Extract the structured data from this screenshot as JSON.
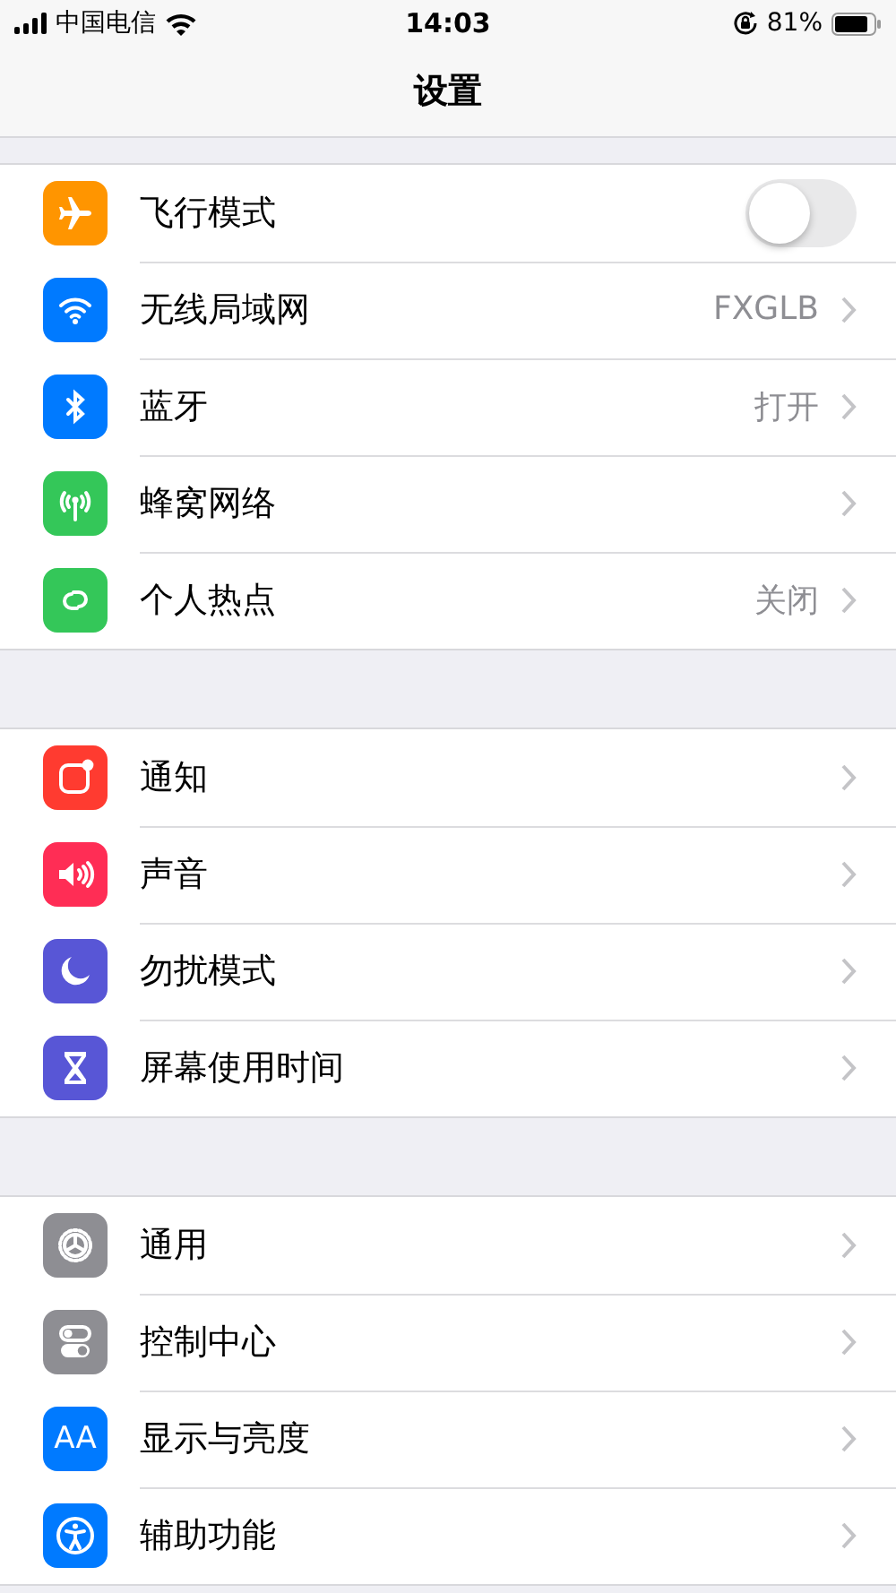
{
  "status_bar": {
    "carrier": "中国电信",
    "time": "14:03",
    "battery": "81%"
  },
  "title": "设置",
  "groups": [
    {
      "items": [
        {
          "kind": "toggle",
          "color": "#ff9500",
          "label": "飞行模式",
          "on": false
        },
        {
          "kind": "link",
          "color": "#007aff",
          "label": "无线局域网",
          "value": "FXGLB"
        },
        {
          "kind": "link",
          "color": "#007aff",
          "label": "蓝牙",
          "value": "打开"
        },
        {
          "kind": "link",
          "color": "#34c759",
          "label": "蜂窝网络"
        },
        {
          "kind": "link",
          "color": "#34c759",
          "label": "个人热点",
          "value": "关闭"
        }
      ]
    },
    {
      "items": [
        {
          "kind": "link",
          "color": "#ff3b30",
          "label": "通知"
        },
        {
          "kind": "link",
          "color": "#ff2d55",
          "label": "声音"
        },
        {
          "kind": "link",
          "color": "#5856d6",
          "label": "勿扰模式"
        },
        {
          "kind": "link",
          "color": "#5856d6",
          "label": "屏幕使用时间"
        }
      ]
    },
    {
      "items": [
        {
          "kind": "link",
          "color": "#8e8e93",
          "label": "通用"
        },
        {
          "kind": "link",
          "color": "#8e8e93",
          "label": "控制中心"
        },
        {
          "kind": "link",
          "icon_text": "AA",
          "color": "#007aff",
          "label": "显示与亮度"
        },
        {
          "kind": "link",
          "color": "#007aff",
          "label": "辅助功能"
        }
      ]
    }
  ]
}
